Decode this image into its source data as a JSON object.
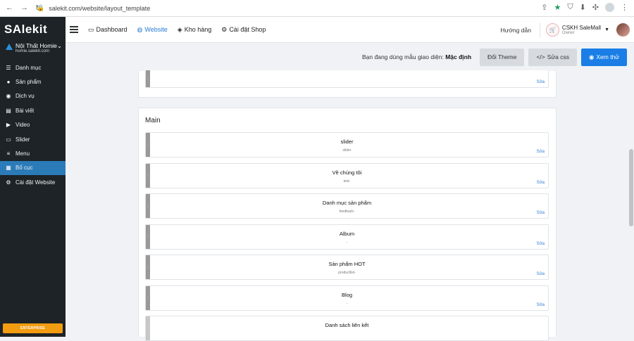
{
  "browser": {
    "url": "salekit.com/website/layout_template"
  },
  "sidebar": {
    "logo": "SAlekit",
    "shop_name": "Nội Thất Homie",
    "shop_domain": "homie.salekit.com",
    "items": [
      {
        "label": "Danh mục",
        "icon": "list-icon",
        "glyph": "☰",
        "active": false
      },
      {
        "label": "Sản phẩm",
        "icon": "product-icon",
        "glyph": "●",
        "active": false
      },
      {
        "label": "Dịch vụ",
        "icon": "service-icon",
        "glyph": "◉",
        "active": false
      },
      {
        "label": "Bài viết",
        "icon": "post-icon",
        "glyph": "▤",
        "active": false
      },
      {
        "label": "Video",
        "icon": "video-icon",
        "glyph": "▶",
        "active": false
      },
      {
        "label": "Slider",
        "icon": "slider-icon",
        "glyph": "▭",
        "active": false
      },
      {
        "label": "Menu",
        "icon": "menu-icon",
        "glyph": "≡",
        "active": false
      },
      {
        "label": "Bố cục",
        "icon": "layout-icon",
        "glyph": "▦",
        "active": true
      },
      {
        "label": "Cài đặt Website",
        "icon": "gear-icon",
        "glyph": "⚙",
        "active": false
      }
    ],
    "enterprise_label": "ENTERPRISE"
  },
  "topnav": {
    "links": [
      {
        "label": "Dashboard",
        "icon": "monitor-icon",
        "glyph": "▭",
        "active": false
      },
      {
        "label": "Website",
        "icon": "globe-icon",
        "glyph": "◍",
        "active": true
      },
      {
        "label": "Kho hàng",
        "icon": "stack-icon",
        "glyph": "◈",
        "active": false
      },
      {
        "label": "Cài đặt Shop",
        "icon": "gear-icon",
        "glyph": "⚙",
        "active": false
      }
    ],
    "help": "Hướng dẫn",
    "account_name": "CSKH SaleMall",
    "account_role": "Owner"
  },
  "toolbar": {
    "status_prefix": "Bạn đang dùng mẫu giao diện:",
    "status_value": "Mặc định",
    "change_theme": "Đổi Theme",
    "edit_css": "Sửa css",
    "preview": "Xem thử"
  },
  "layout": {
    "top_edit": "Sửa",
    "main_title": "Main",
    "blocks": [
      {
        "name": "slider",
        "sub": "slider",
        "edit": "Sửa"
      },
      {
        "name": "Về chúng tôi",
        "sub": "text-",
        "edit": "Sửa"
      },
      {
        "name": "Danh mục sản phẩm",
        "sub": "feedback-",
        "edit": "Sửa"
      },
      {
        "name": "Album",
        "sub": "-",
        "edit": "Sửa"
      },
      {
        "name": "Sản phẩm HOT",
        "sub": "productlist-",
        "edit": "Sửa"
      },
      {
        "name": "Blog",
        "sub": "-",
        "edit": "Sửa"
      },
      {
        "name": "Danh sách liên kết",
        "sub": "",
        "edit": ""
      }
    ]
  },
  "colors": {
    "sidebar_bg": "#1d2327",
    "active_blue": "#2a7bb8",
    "primary_button": "#1a7ee6",
    "enterprise_orange": "#f29c11"
  }
}
